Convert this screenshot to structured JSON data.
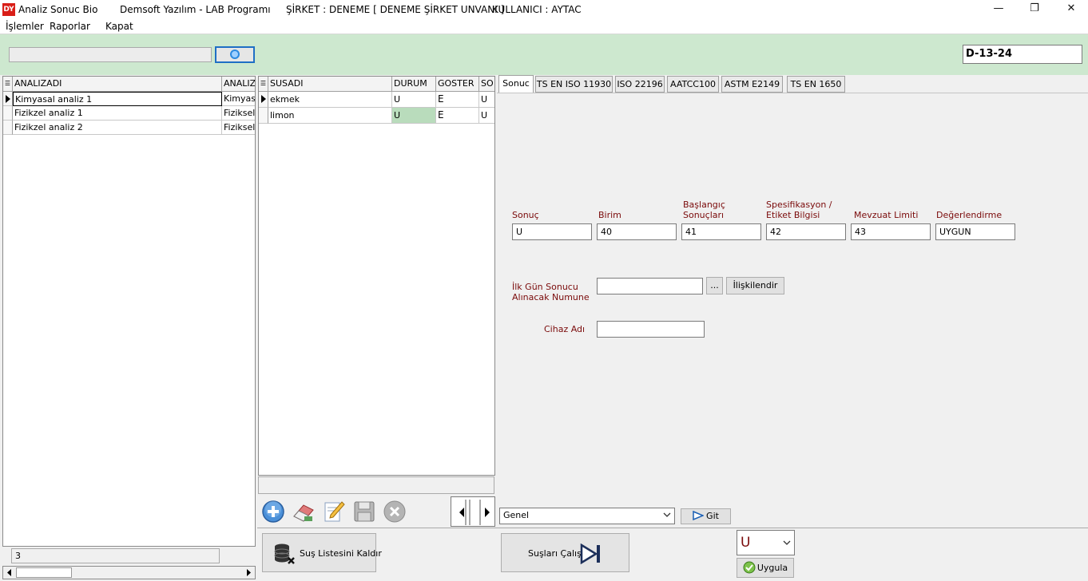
{
  "titlebar": {
    "app_icon_text": "DY",
    "app_name": "Analiz Sonuc Bio",
    "company": "Demsoft Yazılım - LAB Programı",
    "sirket": "ŞİRKET : DENEME [ DENEME ŞİRKET UNVANI ]",
    "kullanici": "KULLANICI : AYTAC",
    "minimize": "—",
    "restore": "❐",
    "close": "✕"
  },
  "menu": {
    "items": [
      "İşlemler",
      "Raporlar",
      "Kapat"
    ]
  },
  "toolbar": {
    "search_value": "",
    "code_value": "D-13-24"
  },
  "analysis_grid": {
    "columns": [
      "ANALIZADI",
      "ANALIZ"
    ],
    "rows": [
      [
        "Kimyasal analiz 1",
        "Kimyasa"
      ],
      [
        "Fizikzel analiz 1",
        "Fiziksel"
      ],
      [
        "Fizikzel analiz 2",
        "Fiziksel"
      ]
    ],
    "count": "3"
  },
  "strain_grid": {
    "columns": [
      "SUSADI",
      "DURUM",
      "GOSTER",
      "SO"
    ],
    "rows": [
      [
        "ekmek",
        "U",
        "E",
        "U"
      ],
      [
        "limon",
        "U",
        "E",
        "U"
      ]
    ]
  },
  "tabs": [
    "Sonuc",
    "TS EN ISO 11930",
    "ISO 22196",
    "AATCC100",
    "ASTM E2149",
    "TS EN 1650"
  ],
  "result_form": {
    "labels": {
      "sonuc": "Sonuç",
      "birim": "Birim",
      "baslangic_1": "Başlangıç",
      "baslangic_2": "Sonuçları",
      "spesifikasyon_1": "Spesifikasyon /",
      "spesifikasyon_2": "Etiket Bilgisi",
      "mevzuat": "Mevzuat Limiti",
      "degerlendirme": "Değerlendirme"
    },
    "values": {
      "sonuc": "U",
      "birim": "40",
      "baslangic": "41",
      "spesifikasyon": "42",
      "mevzuat": "43",
      "degerlendirme": "UYGUN"
    },
    "ilk_gun_label_1": "İlk Gün Sonucu",
    "ilk_gun_label_2": "Alınacak Numune",
    "ilk_gun_value": "",
    "ellipsis_label": "...",
    "iliskilendir_label": "İlişkilendir",
    "cihaz_label": "Cihaz Adı",
    "cihaz_value": ""
  },
  "bottom": {
    "genel_value": "Genel",
    "git_label": "Git",
    "sus_listesi_label": "Suş Listesini Kaldır",
    "suslari_calis_label": "Suşları Çalış",
    "result_select_value": "U",
    "uygula_label": "Uygula"
  },
  "colors": {
    "toolbar_bg": "#cde8cf",
    "label_color": "#7a0a0a",
    "durum_highlight": "#b9dcbc"
  }
}
